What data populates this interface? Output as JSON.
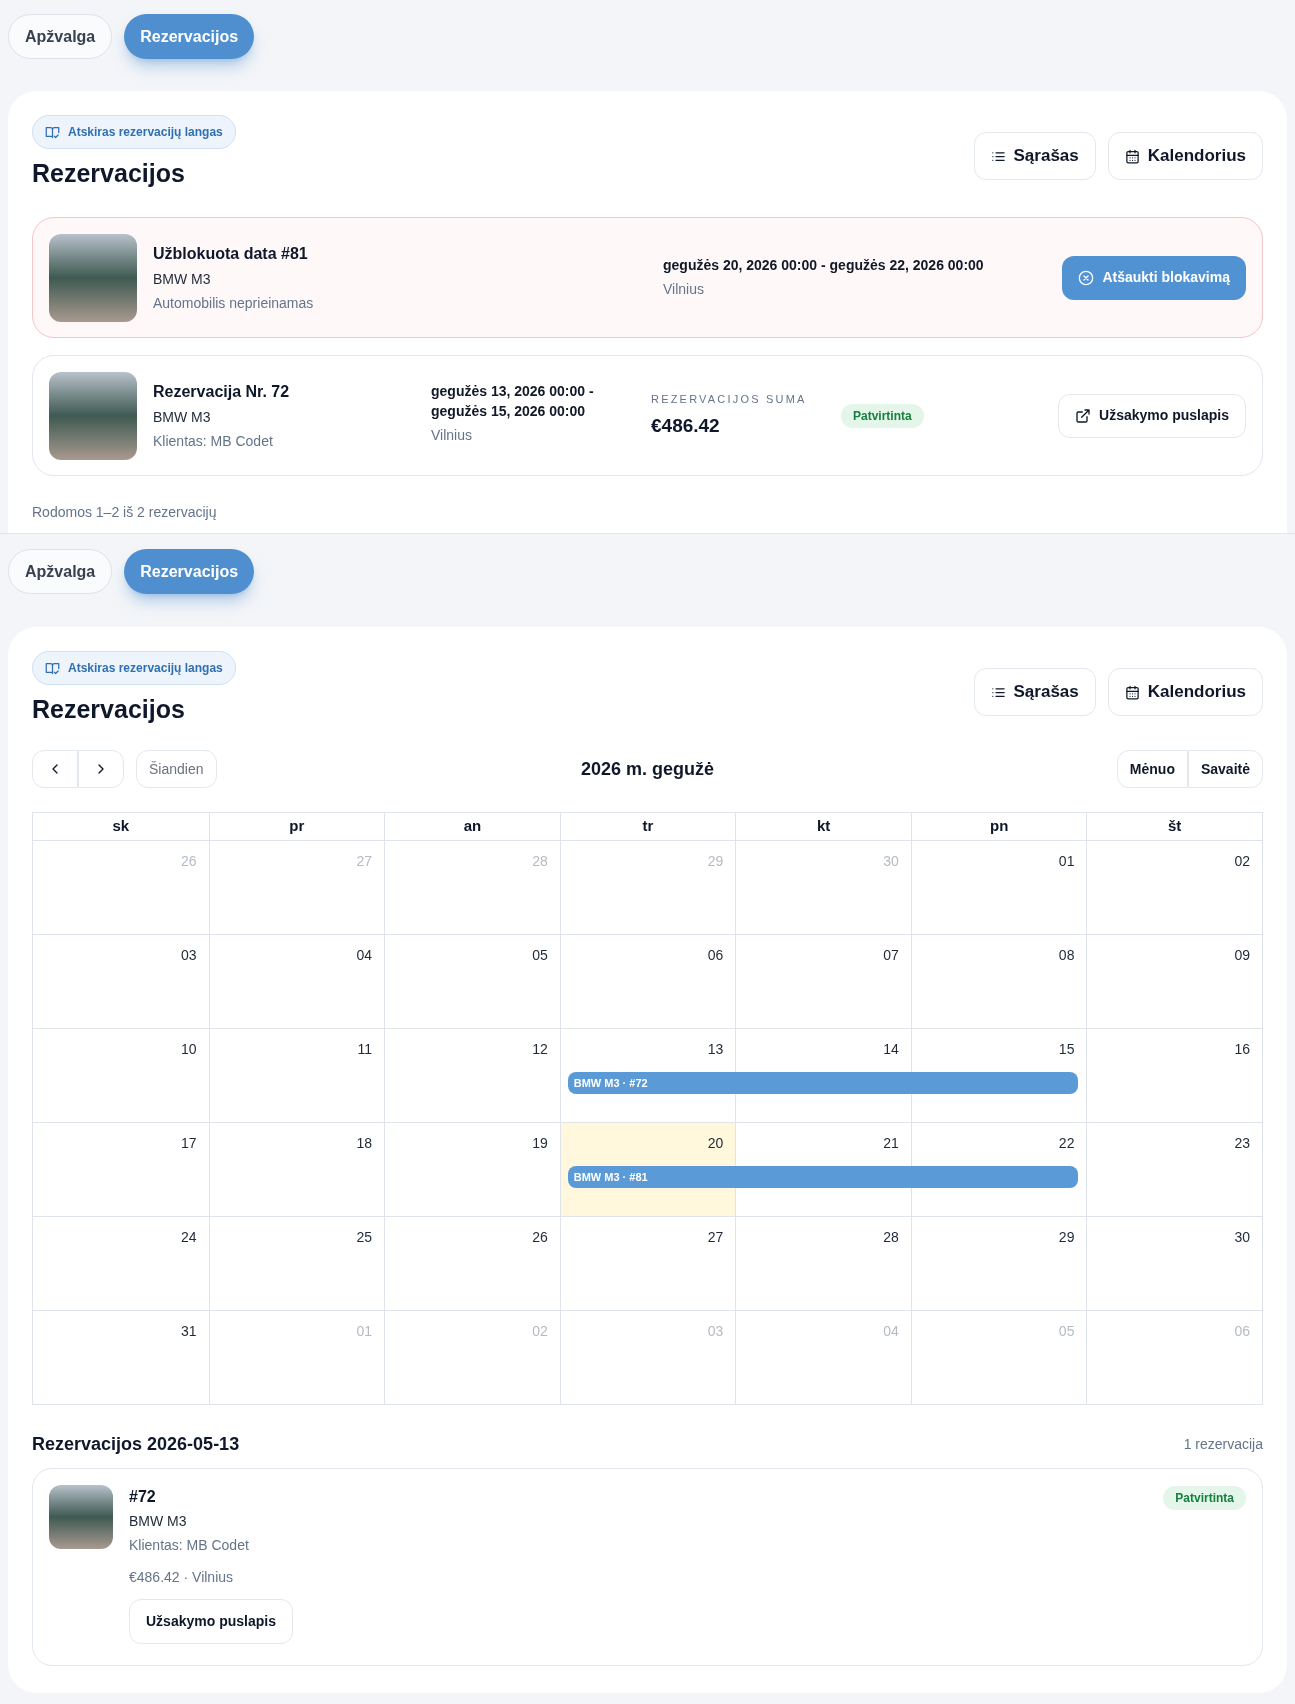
{
  "views": [
    {
      "kind": "list",
      "tabs": [
        {
          "label": "Apžvalga",
          "selected": false
        },
        {
          "label": "Rezervacijos",
          "selected": true
        }
      ],
      "window_link": "Atskiras rezervacijų langas",
      "title": "Rezervacijos",
      "view_buttons": [
        {
          "label": "Sąrašas",
          "kind": "list"
        },
        {
          "label": "Kalendorius",
          "kind": "calendar"
        }
      ],
      "reservations": [
        {
          "kind": "blocked",
          "title": "Užblokuota data #81",
          "car": "BMW M3",
          "note": "Automobilis neprieinamas",
          "dates": "gegužės 20, 2026 00:00 - gegužės 22, 2026 00:00",
          "location": "Vilnius",
          "action": {
            "label": "Atšaukti blokavimą",
            "kind": "cancel"
          }
        },
        {
          "kind": "booking",
          "title": "Rezervacija Nr. 72",
          "car": "BMW M3",
          "note": "Klientas: MB Codet",
          "dates": "gegužės 13, 2026 00:00 - gegužės 15, 2026 00:00",
          "location": "Vilnius",
          "amount_label": "REZERVACIJOS SUMA",
          "amount": "€486.42",
          "status": {
            "label": "Patvirtinta",
            "kind": "confirmed"
          },
          "action": {
            "label": "Užsakymo puslapis",
            "kind": "open"
          }
        }
      ],
      "footer": "Rodomos 1–2 iš 2 rezervacijų"
    },
    {
      "kind": "calendar",
      "tabs": [
        {
          "label": "Apžvalga",
          "selected": false
        },
        {
          "label": "Rezervacijos",
          "selected": true
        }
      ],
      "window_link": "Atskiras rezervacijų langas",
      "title": "Rezervacijos",
      "view_buttons": [
        {
          "label": "Sąrašas",
          "kind": "list"
        },
        {
          "label": "Kalendorius",
          "kind": "calendar"
        }
      ],
      "calendar": {
        "today_button": {
          "label": "Šiandien",
          "disabled": true
        },
        "month": "2026 m. gegužė",
        "modes": [
          "Mėnuo",
          "Savaitė"
        ],
        "weekdays": [
          "sk",
          "pr",
          "an",
          "tr",
          "kt",
          "pn",
          "št"
        ],
        "weeks": [
          [
            {
              "label": "26",
              "muted": true
            },
            {
              "label": "27",
              "muted": true
            },
            {
              "label": "28",
              "muted": true
            },
            {
              "label": "29",
              "muted": true
            },
            {
              "label": "30",
              "muted": true
            },
            {
              "label": "01",
              "muted": false
            },
            {
              "label": "02",
              "muted": false
            }
          ],
          [
            {
              "label": "03",
              "muted": false
            },
            {
              "label": "04",
              "muted": false
            },
            {
              "label": "05",
              "muted": false
            },
            {
              "label": "06",
              "muted": false
            },
            {
              "label": "07",
              "muted": false
            },
            {
              "label": "08",
              "muted": false
            },
            {
              "label": "09",
              "muted": false
            }
          ],
          [
            {
              "label": "10",
              "muted": false
            },
            {
              "label": "11",
              "muted": false
            },
            {
              "label": "12",
              "muted": false
            },
            {
              "label": "13",
              "muted": false,
              "event": "BMW M3 · #72"
            },
            {
              "label": "14",
              "muted": false,
              "continues": true
            },
            {
              "label": "15",
              "muted": false,
              "continues": true
            },
            {
              "label": "16",
              "muted": false
            }
          ],
          [
            {
              "label": "17",
              "muted": false
            },
            {
              "label": "18",
              "muted": false
            },
            {
              "label": "19",
              "muted": false
            },
            {
              "label": "20",
              "muted": false,
              "today": true,
              "event": "BMW M3 · #81"
            },
            {
              "label": "21",
              "muted": false,
              "continues": true
            },
            {
              "label": "22",
              "muted": false,
              "continues": true
            },
            {
              "label": "23",
              "muted": false
            }
          ],
          [
            {
              "label": "24",
              "muted": false
            },
            {
              "label": "25",
              "muted": false
            },
            {
              "label": "26",
              "muted": false
            },
            {
              "label": "27",
              "muted": false
            },
            {
              "label": "28",
              "muted": false
            },
            {
              "label": "29",
              "muted": false
            },
            {
              "label": "30",
              "muted": false
            }
          ],
          [
            {
              "label": "31",
              "muted": false
            },
            {
              "label": "01",
              "muted": true
            },
            {
              "label": "02",
              "muted": true
            },
            {
              "label": "03",
              "muted": true
            },
            {
              "label": "04",
              "muted": true
            },
            {
              "label": "05",
              "muted": true
            },
            {
              "label": "06",
              "muted": true
            }
          ]
        ]
      },
      "day_heading": "Rezervacijos 2026-05-13",
      "day_count": "1 rezervacija",
      "day_items": [
        {
          "title": "#72",
          "car": "BMW M3",
          "client": "Klientas: MB Codet",
          "meta": "€486.42 · Vilnius",
          "status": {
            "label": "Patvirtinta",
            "kind": "confirmed"
          },
          "action": "Užsakymo puslapis"
        }
      ]
    }
  ]
}
